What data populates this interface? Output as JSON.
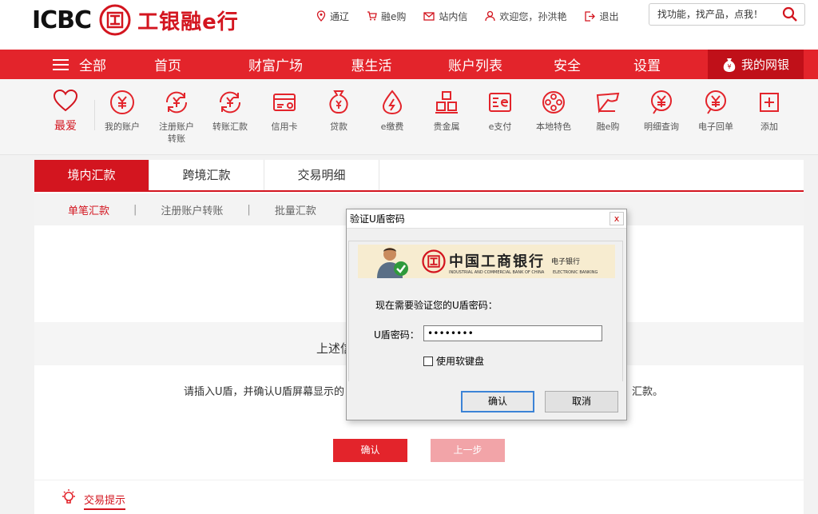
{
  "header": {
    "logo_text": "ICBC",
    "logo_cn": "工银融e行",
    "links": [
      {
        "icon": "location-icon",
        "label": "通辽"
      },
      {
        "icon": "cart-icon",
        "label": "融e购"
      },
      {
        "icon": "mail-icon",
        "label": "站内信"
      },
      {
        "icon": "user-icon",
        "label": "欢迎您，孙洪艳"
      },
      {
        "icon": "logout-icon",
        "label": "退出"
      }
    ],
    "search_placeholder": "找功能，找产品，点我！"
  },
  "nav": {
    "all_label": "全部",
    "items": [
      "首页",
      "财富广场",
      "惠生活",
      "账户列表",
      "安全",
      "设置"
    ],
    "mybank_label": "我的网银"
  },
  "shortcuts": {
    "fav_label": "最爱",
    "items": [
      {
        "icon": "yuan-circle-icon",
        "label": "我的账户"
      },
      {
        "icon": "yuan-transfer-icon",
        "label": "注册账户转账"
      },
      {
        "icon": "yuan-transfer-icon",
        "label": "转账汇款"
      },
      {
        "icon": "credit-card-icon",
        "label": "信用卡"
      },
      {
        "icon": "money-bag-icon",
        "label": "贷款"
      },
      {
        "icon": "drop-icon",
        "label": "e缴费"
      },
      {
        "icon": "gold-bars-icon",
        "label": "贵金属"
      },
      {
        "icon": "e-pay-icon",
        "label": "e支付"
      },
      {
        "icon": "film-reel-icon",
        "label": "本地特色"
      },
      {
        "icon": "shop-icon",
        "label": "融e购"
      },
      {
        "icon": "yuan-query-icon",
        "label": "明细查询"
      },
      {
        "icon": "yuan-receipt-icon",
        "label": "电子回单"
      },
      {
        "icon": "plus-square-icon",
        "label": "添加"
      }
    ]
  },
  "tabs": [
    "境内汇款",
    "跨境汇款",
    "交易明细"
  ],
  "subtabs": [
    "单笔汇款",
    "注册账户转账",
    "批量汇款"
  ],
  "content": {
    "band_text": "上述信",
    "instr_left": "请插入U盾，并确认U盾屏幕显示的",
    "instr_right": "汇款。",
    "confirm_button": "确认",
    "prev_button": "上一步",
    "tips_label": "交易提示"
  },
  "dialog": {
    "title": "验证U盾密码",
    "close": "x",
    "banner_cn": "中国工商银行",
    "banner_sub": "电子银行",
    "banner_en1": "INDUSTRIAL AND COMMERCIAL BANK OF CHINA",
    "banner_en2": "ELECTRONIC BANKING",
    "prompt": "现在需要验证您的U盾密码：",
    "password_label": "U盾密码：",
    "password_value": "••••••••",
    "checkbox_label": "使用软键盘",
    "ok_button": "确认",
    "cancel_button": "取消"
  },
  "colors": {
    "brand_red": "#d3151f",
    "nav_red": "#e3242b"
  }
}
